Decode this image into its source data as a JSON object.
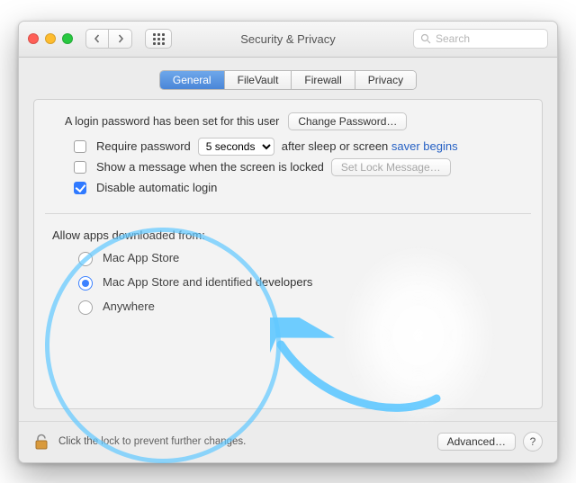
{
  "window": {
    "title": "Security & Privacy",
    "search_placeholder": "Search"
  },
  "tabs": {
    "general": "General",
    "filevault": "FileVault",
    "firewall": "Firewall",
    "privacy": "Privacy"
  },
  "login_section": {
    "intro": "A login password has been set for this user",
    "change_password_btn": "Change Password…",
    "require_password_label_before": "Require password",
    "require_password_delay": "5 seconds",
    "require_password_label_after_1": "after sleep or screen ",
    "require_password_label_after_link": "saver begins",
    "show_message_label": "Show a message when the screen is locked",
    "set_lock_message_btn": "Set Lock Message…",
    "disable_auto_login_label": "Disable automatic login"
  },
  "allow_apps": {
    "title": "Allow apps downloaded from:",
    "option_mas": "Mac App Store",
    "option_mas_dev": "Mac App Store and identified developers",
    "option_anywhere": "Anywhere",
    "selected": "mas_dev"
  },
  "footer": {
    "lock_text": "Click the lock to prevent further changes.",
    "advanced_btn": "Advanced…"
  }
}
